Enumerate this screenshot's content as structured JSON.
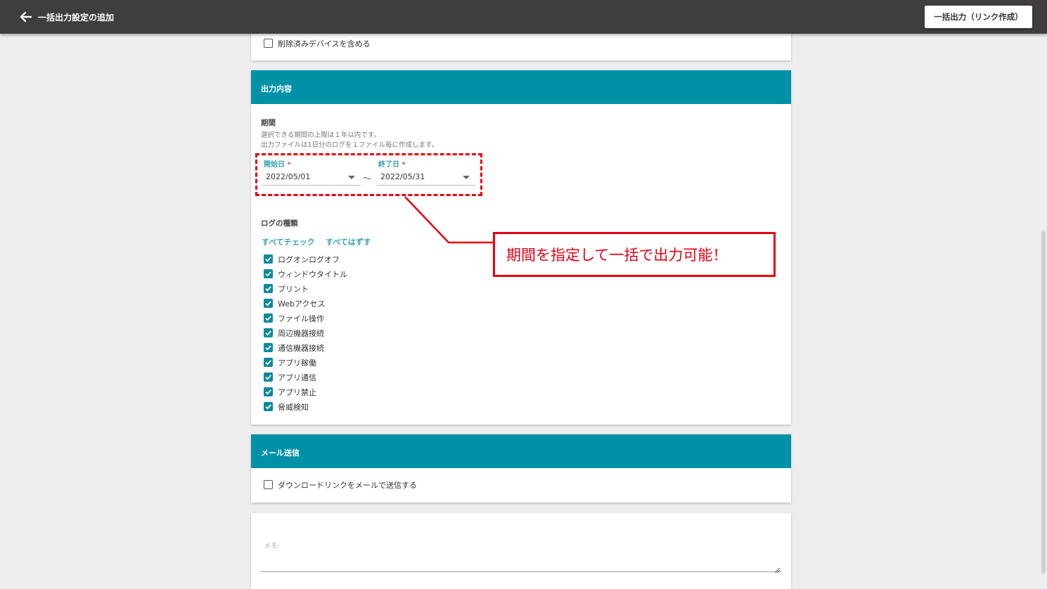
{
  "topbar": {
    "back_icon": "arrow-left-icon",
    "title": "一括出力設定の追加",
    "export_button": "一括出力（リンク作成）"
  },
  "device_card": {
    "include_deleted_label": "削除済みデバイスを含める",
    "include_deleted_checked": false
  },
  "output_card": {
    "header": "出力内容",
    "period_label": "期間",
    "period_help_1": "選択できる期間の上限は１年以内です。",
    "period_help_2": "出力ファイルは1日分のログを１ファイル毎に作成します。",
    "start_date": {
      "label": "開始日",
      "required_mark": "*",
      "value": "2022/05/01"
    },
    "end_date": {
      "label": "終了日",
      "required_mark": "*",
      "value": "2022/05/31"
    },
    "range_separator": "～",
    "log_types_label": "ログの種類",
    "check_all": "すべてチェック",
    "uncheck_all": "すべてはずす",
    "log_types": [
      {
        "label": "ログオンログオフ",
        "checked": true
      },
      {
        "label": "ウィンドウタイトル",
        "checked": true
      },
      {
        "label": "プリント",
        "checked": true
      },
      {
        "label": "Webアクセス",
        "checked": true
      },
      {
        "label": "ファイル操作",
        "checked": true
      },
      {
        "label": "周辺機器接続",
        "checked": true
      },
      {
        "label": "通信機器接続",
        "checked": true
      },
      {
        "label": "アプリ稼働",
        "checked": true
      },
      {
        "label": "アプリ通信",
        "checked": true
      },
      {
        "label": "アプリ禁止",
        "checked": true
      },
      {
        "label": "脅威検知",
        "checked": true
      }
    ]
  },
  "mail_card": {
    "header": "メール送信",
    "send_link_label": "ダウンロードリンクをメールで送信する",
    "send_link_checked": false
  },
  "memo_card": {
    "placeholder": "メモ"
  },
  "annotation": {
    "callout_text": "期間を指定して一括で出力可能！",
    "color": "#e60012"
  },
  "colors": {
    "topbar": "#403e3c",
    "section_header": "#0091a7",
    "accent": "#3aa1b5",
    "checkbox": "#0c8a9d"
  }
}
